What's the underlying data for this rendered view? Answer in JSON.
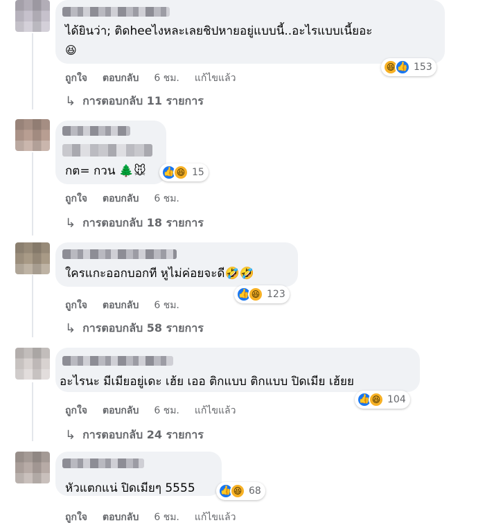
{
  "comments": [
    {
      "text": "ได้ยินว่า; ติดheeไงหละเลยชิปหายอยู่แบบนี้..อะไรแบบเนี้ยอะ",
      "text2": "😆",
      "react_icons": [
        "like-icon",
        "haha-icon"
      ],
      "react_count": "153",
      "like": "ถูกใจ",
      "reply": "ตอบกลับ",
      "time": "6 ชม.",
      "edited": "แก้ไขแล้ว",
      "replies": "การตอบกลับ 11 รายการ"
    },
    {
      "text": "กต= กวน 🌲🐭",
      "react_count": "15",
      "like": "ถูกใจ",
      "reply": "ตอบกลับ",
      "time": "6 ชม.",
      "replies": "การตอบกลับ 18 รายการ"
    },
    {
      "text": "ใครแกะออกบอกที หูไม่ค่อยจะดี🤣🤣",
      "react_count": "123",
      "like": "ถูกใจ",
      "reply": "ตอบกลับ",
      "time": "6 ชม.",
      "replies": "การตอบกลับ 58 รายการ"
    },
    {
      "text": "อะไรนะ มีเมียอยู่เดะ เฮ้ย เออ ติกแบบ ติกแบบ ปิดเมีย เฮ้ยย",
      "react_count": "104",
      "like": "ถูกใจ",
      "reply": "ตอบกลับ",
      "time": "6 ชม.",
      "edited": "แก้ไขแล้ว",
      "replies": "การตอบกลับ 24 รายการ"
    },
    {
      "text": "หัวแตกแน่ ปิดเมียๆ 5555",
      "react_count": "68",
      "like": "ถูกใจ",
      "reply": "ตอบกลับ",
      "time": "6 ชม.",
      "edited": "แก้ไขแล้ว"
    }
  ],
  "icons": {
    "like": "👍",
    "haha": "😆",
    "reply_arrow": "↳"
  },
  "colors": {
    "bubble": "#f0f2f5",
    "meta": "#65676b",
    "like_blue": "#1877f2",
    "haha_yellow": "#f7b125"
  }
}
